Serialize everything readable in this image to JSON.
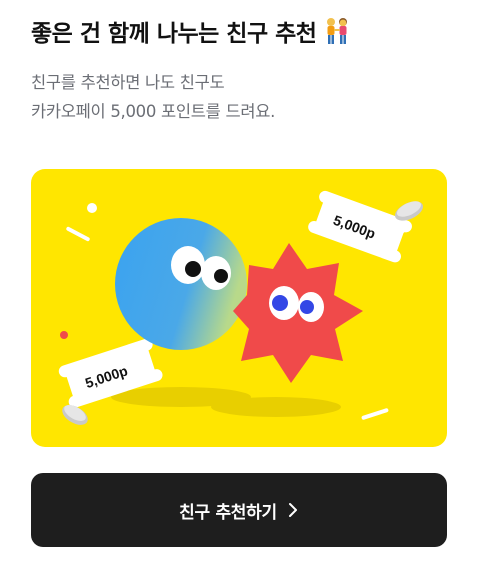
{
  "header": {
    "title": "좋은 건 함께 나누는 친구 추천",
    "title_icon": "two-people-emoji",
    "subtitle_line1": "친구를 추천하면 나도 친구도",
    "subtitle_line2": "카카오페이 5,000 포인트를 드려요."
  },
  "banner": {
    "background": "#ffe600",
    "ticket_top_text": "5,000p",
    "ticket_bottom_text": "5,000p",
    "blue_character_color": "#3aa3f0",
    "red_character_color": "#f04a4a"
  },
  "cta": {
    "label": "친구 추천하기",
    "icon": "chevron-right-icon",
    "background": "#1e1e1e"
  }
}
